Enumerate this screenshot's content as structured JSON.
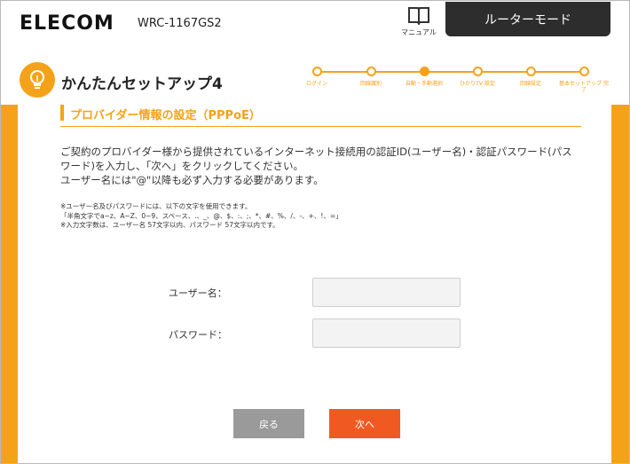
{
  "header": {
    "brand": "ELECOM",
    "model": "WRC-1167GS2",
    "manual_label": "マニュアル",
    "mode": "ルーターモード"
  },
  "page": {
    "title": "かんたんセットアップ4"
  },
  "steps": [
    {
      "label": "ログイン",
      "active": false
    },
    {
      "label": "回線識別",
      "active": false
    },
    {
      "label": "自動・手動選択",
      "active": true
    },
    {
      "label": "ひかりTV 設定",
      "active": false
    },
    {
      "label": "回線設定",
      "active": false
    },
    {
      "label": "基本セットアップ 完了",
      "active": false
    }
  ],
  "section": {
    "title": "プロバイダー情報の設定（PPPoE）"
  },
  "description": {
    "line1": "ご契約のプロバイダー様から提供されているインターネット接続用の認証ID(ユーザー名)・認証パスワード(パス",
    "line2": "ワード)を入力し、「次へ」をクリックしてください。",
    "line3": "ユーザー名には\"@\"以降も必ず入力する必要があります。"
  },
  "notes": {
    "line1": "※ユーザー名及びパスワードには、以下の文字を使用できます。",
    "line2": "「半角文字でa~z、A~Z、0~9、スペース、.、_、@、$、:、;、*、#、%、/、-、+、!、=」",
    "line3": "※入力文字数は、ユーザー名 57文字以内、パスワード 57文字以内です。"
  },
  "form": {
    "username_label": "ユーザー名：",
    "username_value": "",
    "password_label": "パスワード：",
    "password_value": ""
  },
  "buttons": {
    "back": "戻る",
    "next": "次へ"
  },
  "colors": {
    "accent": "#f5a21b",
    "next_button": "#f05a22",
    "back_button": "#9a9a9a",
    "mode_badge": "#2d2d2d"
  }
}
